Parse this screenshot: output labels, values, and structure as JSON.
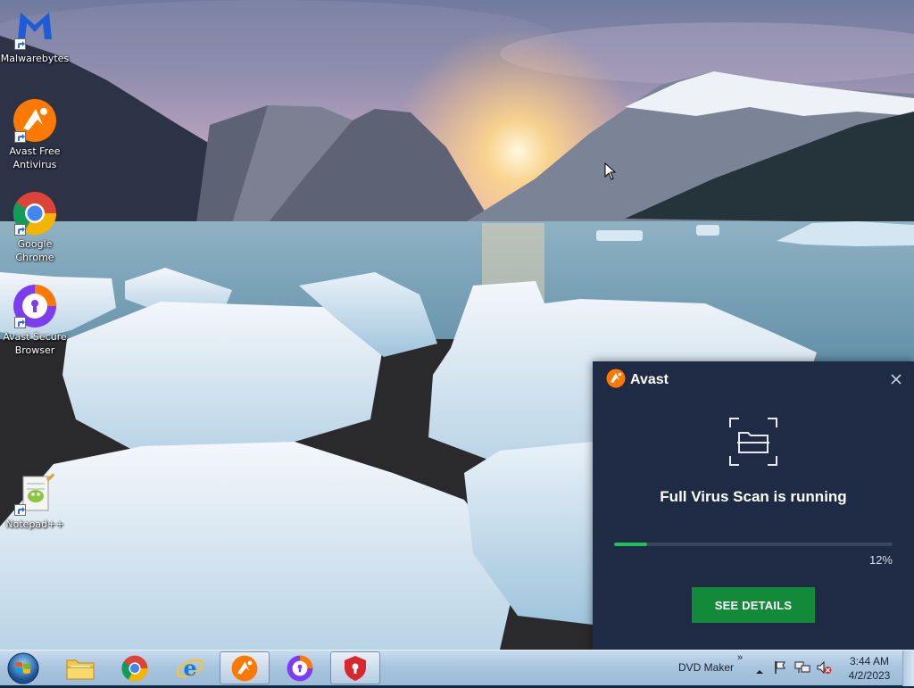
{
  "desktop": {
    "icons": [
      {
        "label": "Malwarebytes",
        "icon": "malwarebytes-icon"
      },
      {
        "label": "Avast Free Antivirus",
        "icon": "avast-antivirus-icon"
      },
      {
        "label": "Google Chrome",
        "icon": "chrome-icon"
      },
      {
        "label": "Avast Secure Browser",
        "icon": "avast-secure-browser-icon"
      },
      {
        "label": "Notepad++",
        "icon": "notepadpp-icon"
      }
    ]
  },
  "popup": {
    "brand": "Avast",
    "scan_title": "Full Virus Scan is running",
    "progress": 0.12,
    "percent_label": "12%",
    "button_label": "SEE DETAILS",
    "colors": {
      "background": "#1f2a44",
      "accent": "#1fc15a",
      "button": "#138a3a",
      "brand": "#ff7800"
    }
  },
  "taskbar": {
    "apps": [
      {
        "name": "explorer",
        "icon": "folder-icon"
      },
      {
        "name": "chrome",
        "icon": "chrome-icon"
      },
      {
        "name": "internet-explorer",
        "icon": "ie-icon"
      },
      {
        "name": "avast",
        "icon": "avast-antivirus-icon"
      },
      {
        "name": "avast-secure-browser",
        "icon": "avast-secure-browser-icon"
      },
      {
        "name": "avast-shield",
        "icon": "shield-icon"
      }
    ],
    "toolbar_label": "DVD Maker",
    "toolbar_chevron": "»",
    "clock_time": "3:44 AM",
    "clock_date": "4/2/2023"
  }
}
